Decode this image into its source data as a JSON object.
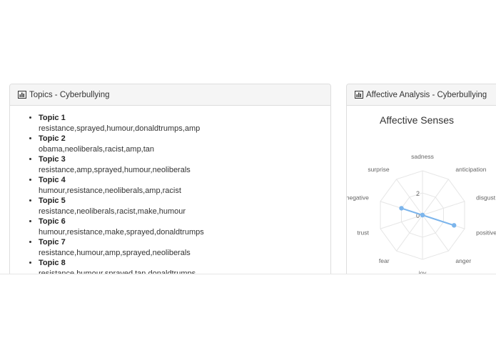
{
  "topics_panel": {
    "title": "Topics - Cyberbullying",
    "topics": [
      {
        "label": "Topic 1",
        "words": "resistance,sprayed,humour,donaldtrumps,amp"
      },
      {
        "label": "Topic 2",
        "words": "obama,neoliberals,racist,amp,tan"
      },
      {
        "label": "Topic 3",
        "words": "resistance,amp,sprayed,humour,neoliberals"
      },
      {
        "label": "Topic 4",
        "words": "humour,resistance,neoliberals,amp,racist"
      },
      {
        "label": "Topic 5",
        "words": "resistance,neoliberals,racist,make,humour"
      },
      {
        "label": "Topic 6",
        "words": "humour,resistance,make,sprayed,donaldtrumps"
      },
      {
        "label": "Topic 7",
        "words": "resistance,humour,amp,sprayed,neoliberals"
      },
      {
        "label": "Topic 8",
        "words": "resistance,humour,sprayed,tan,donaldtrumps"
      }
    ]
  },
  "affect_panel": {
    "title": "Affective Analysis - Cyberbullying"
  },
  "icon": "bar-chart-icon",
  "accent_color": "#7cb5ec",
  "chart_data": {
    "type": "radar",
    "title": "Affective Senses",
    "categories": [
      "sadness",
      "anticipation",
      "disgust",
      "positive",
      "anger",
      "joy",
      "fear",
      "trust",
      "negative",
      "surprise"
    ],
    "tick_labels": [
      "0",
      "2"
    ],
    "ylim": [
      0,
      4
    ],
    "series": [
      {
        "values": [
          0,
          0,
          0,
          3,
          0,
          0,
          0,
          0,
          2,
          0
        ]
      }
    ],
    "grid": true
  }
}
